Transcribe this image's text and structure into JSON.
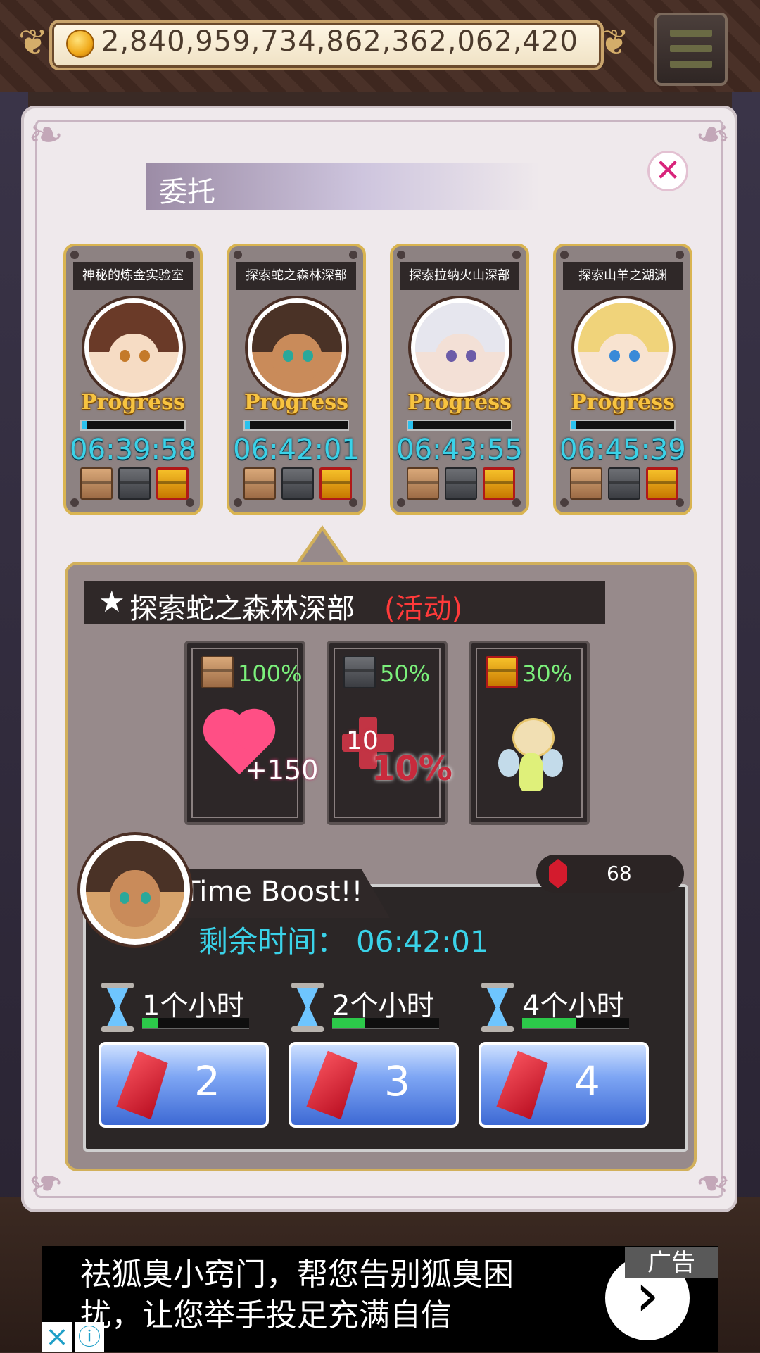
{
  "header": {
    "coins": "2,840,959,734,862,362,062,420",
    "menu_icon": "hamburger-menu-icon"
  },
  "panel": {
    "title": "委托",
    "close_icon": "close-icon",
    "progress_label": "Progress"
  },
  "quests": [
    {
      "name": "神秘的炼金实验室",
      "timer": "06:39:58",
      "progress": 0.05,
      "hair": "#6a3a28",
      "skin": "#f6dcc4",
      "eye": "#c47a2a"
    },
    {
      "name": "探索蛇之森林深部",
      "timer": "06:42:01",
      "progress": 0.05,
      "hair": "#4a3226",
      "skin": "#c98b5a",
      "eye": "#2aa89a"
    },
    {
      "name": "探索拉纳火山深部",
      "timer": "06:43:55",
      "progress": 0.05,
      "hair": "#e6e6ee",
      "skin": "#f3e0d6",
      "eye": "#6b5ba8"
    },
    {
      "name": "探索山羊之湖渊",
      "timer": "06:45:39",
      "progress": 0.05,
      "hair": "#f0d37a",
      "skin": "#f8e3d0",
      "eye": "#3a8ad8"
    }
  ],
  "selected_quest": {
    "star": "★",
    "name": "探索蛇之森林深部",
    "tag": "(活动)",
    "rewards": [
      {
        "chest": "wooden-chest-icon",
        "chance": "100%",
        "item_icon": "heart-icon",
        "amount": "+150"
      },
      {
        "chest": "iron-chest-icon",
        "chance": "50%",
        "item_icon": "health-cross-icon",
        "badge": "10",
        "amount": "10%"
      },
      {
        "chest": "golden-chest-icon",
        "chance": "30%",
        "item_icon": "fairy-icon"
      }
    ]
  },
  "time_boost": {
    "title": "Time Boost!!",
    "gems": "68",
    "remaining_label": "剩余时间：",
    "remaining_time": "06:42:01",
    "options": [
      {
        "label": "1个小时",
        "cost": "2",
        "fill": 0.15
      },
      {
        "label": "2个小时",
        "cost": "3",
        "fill": 0.3
      },
      {
        "label": "4个小时",
        "cost": "4",
        "fill": 0.5
      }
    ]
  },
  "ad": {
    "text": "祛狐臭小窍门，帮您告别狐臭困扰，让您举手投足充满自信",
    "tag": "广告",
    "arrow": "›",
    "close": "×",
    "info": "ⓘ"
  },
  "colors": {
    "accent_cyan": "#3ad2e8",
    "event_red": "#ff3a3a",
    "chance_green": "#7bf07b",
    "card_gold": "#d9b451"
  }
}
